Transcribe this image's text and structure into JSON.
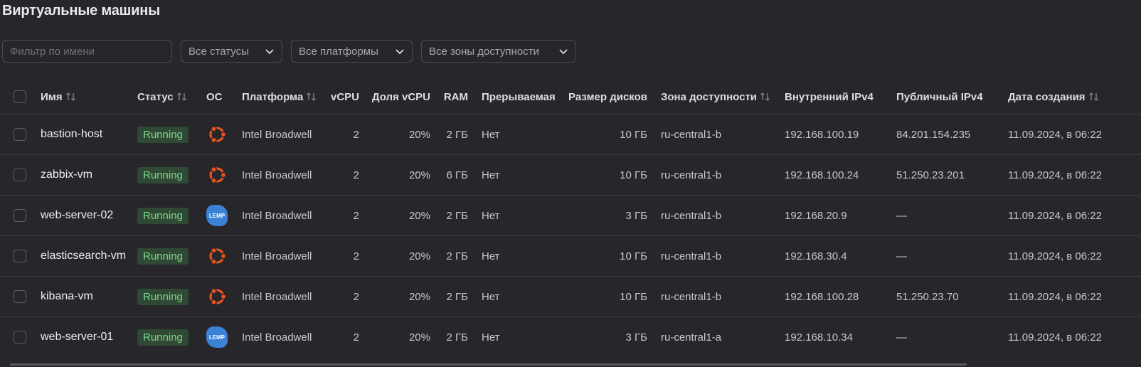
{
  "page": {
    "title": "Виртуальные машины"
  },
  "filters": {
    "name_placeholder": "Фильтр по имени",
    "status": "Все статусы",
    "platform": "Все платформы",
    "zone": "Все зоны доступности"
  },
  "columns": {
    "name": "Имя",
    "status": "Статус",
    "os": "ОС",
    "platform": "Платформа",
    "vcpu": "vCPU",
    "vcpu_share": "Доля vCPU",
    "ram": "RAM",
    "preemptible": "Прерываемая",
    "disk_size": "Размер дисков",
    "zone": "Зона доступности",
    "internal_ip": "Внутренний IPv4",
    "public_ip": "Публичный IPv4",
    "created": "Дата создания"
  },
  "colors": {
    "running_bg": "#2f4934",
    "running_text": "#7ed68a",
    "ubuntu": "#e95420",
    "lemp": "#3b82d6"
  },
  "vms": [
    {
      "name": "bastion-host",
      "status": "Running",
      "os_icon": "ubuntu-icon",
      "platform": "Intel Broadwell",
      "vcpu": "2",
      "vcpu_share": "20%",
      "ram": "2 ГБ",
      "preemptible": "Нет",
      "disk": "10 ГБ",
      "zone": "ru-central1-b",
      "internal_ip": "192.168.100.19",
      "public_ip": "84.201.154.235",
      "created": "11.09.2024, в 06:22"
    },
    {
      "name": "zabbix-vm",
      "status": "Running",
      "os_icon": "ubuntu-icon",
      "platform": "Intel Broadwell",
      "vcpu": "2",
      "vcpu_share": "20%",
      "ram": "6 ГБ",
      "preemptible": "Нет",
      "disk": "10 ГБ",
      "zone": "ru-central1-b",
      "internal_ip": "192.168.100.24",
      "public_ip": "51.250.23.201",
      "created": "11.09.2024, в 06:22"
    },
    {
      "name": "web-server-02",
      "status": "Running",
      "os_icon": "lemp-icon",
      "os_label": "LEMP",
      "platform": "Intel Broadwell",
      "vcpu": "2",
      "vcpu_share": "20%",
      "ram": "2 ГБ",
      "preemptible": "Нет",
      "disk": "3 ГБ",
      "zone": "ru-central1-b",
      "internal_ip": "192.168.20.9",
      "public_ip": "—",
      "created": "11.09.2024, в 06:22"
    },
    {
      "name": "elasticsearch-vm",
      "status": "Running",
      "os_icon": "ubuntu-icon",
      "platform": "Intel Broadwell",
      "vcpu": "2",
      "vcpu_share": "20%",
      "ram": "2 ГБ",
      "preemptible": "Нет",
      "disk": "10 ГБ",
      "zone": "ru-central1-b",
      "internal_ip": "192.168.30.4",
      "public_ip": "—",
      "created": "11.09.2024, в 06:22"
    },
    {
      "name": "kibana-vm",
      "status": "Running",
      "os_icon": "ubuntu-icon",
      "platform": "Intel Broadwell",
      "vcpu": "2",
      "vcpu_share": "20%",
      "ram": "2 ГБ",
      "preemptible": "Нет",
      "disk": "10 ГБ",
      "zone": "ru-central1-b",
      "internal_ip": "192.168.100.28",
      "public_ip": "51.250.23.70",
      "created": "11.09.2024, в 06:22"
    },
    {
      "name": "web-server-01",
      "status": "Running",
      "os_icon": "lemp-icon",
      "os_label": "LEMP",
      "platform": "Intel Broadwell",
      "vcpu": "2",
      "vcpu_share": "20%",
      "ram": "2 ГБ",
      "preemptible": "Нет",
      "disk": "3 ГБ",
      "zone": "ru-central1-a",
      "internal_ip": "192.168.10.34",
      "public_ip": "—",
      "created": "11.09.2024, в 06:22"
    }
  ]
}
